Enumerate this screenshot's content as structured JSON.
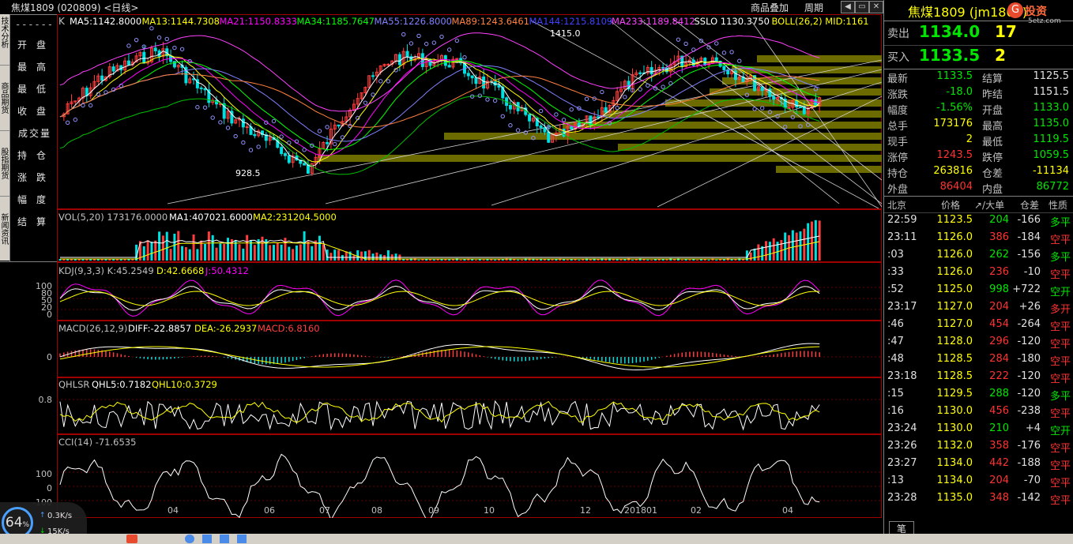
{
  "window": {
    "title": "焦煤1809 (020809) <日线>",
    "links": [
      "商品叠加",
      "周期"
    ]
  },
  "left_tabs": [
    "技术分析",
    "商品期货",
    "股指期货",
    "新闻资讯"
  ],
  "left_menu": [
    "开盘",
    "最高",
    "最低",
    "收盘",
    "成交量",
    "持仓",
    "涨跌",
    "幅度",
    "结算"
  ],
  "main_legend": {
    "prefix": "K",
    "items": [
      {
        "label": "MA5:1142.8000",
        "color": "#ffffff"
      },
      {
        "label": "MA13:1144.7308",
        "color": "#ffff00"
      },
      {
        "label": "MA21:1150.8333",
        "color": "#ff00ff"
      },
      {
        "label": "MA34:1185.7647",
        "color": "#00ff00"
      },
      {
        "label": "MA55:1226.8000",
        "color": "#8080ff"
      },
      {
        "label": "MA89:1243.6461",
        "color": "#ff8040"
      },
      {
        "label": "MA144:1215.8109",
        "color": "#4040ff"
      },
      {
        "label": "MA233:1189.8412",
        "color": "#ff40ff"
      },
      {
        "label": "SSLO 1130.3750",
        "color": "#ffffff"
      },
      {
        "label": "BOLL(26,2) MID:1161",
        "color": "#ffff00"
      }
    ],
    "high_mark": "1415.0",
    "low_mark": "928.5"
  },
  "vol_legend": {
    "prefix": "VOL(5,20) 173176.0000",
    "ma1": "MA1:407021.6000",
    "ma2": "MA2:231204.5000"
  },
  "kdj_legend": {
    "prefix": "KDJ(9,3,3) K:45.2549",
    "d": "D:42.6668",
    "j": "J:50.4312",
    "ticks": [
      "100",
      "80",
      "50",
      "20",
      "0"
    ]
  },
  "macd_legend": {
    "prefix": "MACD(26,12,9)",
    "diff": "DIFF:-22.8857",
    "dea": "DEA:-26.2937",
    "macd": "MACD:6.8160",
    "tick": "0"
  },
  "qhlsr_legend": {
    "prefix": "QHLSR",
    "q5": "QHL5:0.7182",
    "q10": "QHL10:0.3729",
    "tick": "0.8"
  },
  "cci_legend": {
    "prefix": "CCI(14) -71.6535",
    "ticks": [
      "100",
      "0",
      "-100"
    ]
  },
  "x_axis": [
    "04",
    "06",
    "07",
    "08",
    "09",
    "10",
    "12",
    "201801",
    "02",
    "04"
  ],
  "quote": {
    "title": "焦煤1809 (jm1809)",
    "brand": "投资",
    "brand_sub": "5etz.com",
    "sell": {
      "label": "卖出",
      "price": "1134.0",
      "qty": "17"
    },
    "buy": {
      "label": "买入",
      "price": "1133.5",
      "qty": "2"
    },
    "rows": [
      {
        "l1": "最新",
        "v1": "1133.5",
        "c1": "dn",
        "l2": "结算",
        "v2": "1125.5",
        "c2": "wh"
      },
      {
        "l1": "涨跌",
        "v1": "-18.0",
        "c1": "dn",
        "l2": "昨结",
        "v2": "1151.5",
        "c2": "wh"
      },
      {
        "l1": "幅度",
        "v1": "-1.56%",
        "c1": "dn",
        "l2": "开盘",
        "v2": "1133.0",
        "c2": "dn"
      },
      {
        "l1": "总手",
        "v1": "173176",
        "c1": "yl",
        "l2": "最高",
        "v2": "1135.0",
        "c2": "dn"
      },
      {
        "l1": "现手",
        "v1": "2",
        "c1": "yl",
        "l2": "最低",
        "v2": "1119.5",
        "c2": "dn"
      },
      {
        "l1": "涨停",
        "v1": "1243.5",
        "c1": "up",
        "l2": "跌停",
        "v2": "1059.5",
        "c2": "dn"
      },
      {
        "l1": "持仓",
        "v1": "263816",
        "c1": "yl",
        "l2": "仓差",
        "v2": "-11134",
        "c2": "yl"
      },
      {
        "l1": "外盘",
        "v1": "86404",
        "c1": "up",
        "l2": "内盘",
        "v2": "86772",
        "c2": "dn"
      }
    ],
    "tick_header": [
      "北京",
      "价格",
      "↗/大单",
      "仓差",
      "性质"
    ],
    "ticks": [
      {
        "time": "22:59",
        "price": "1123.5",
        "vol": "204",
        "oi": "-166",
        "nature": "多平",
        "nc": "dn"
      },
      {
        "time": "23:11",
        "price": "1126.0",
        "vol": "386",
        "oi": "-184",
        "nature": "空平",
        "nc": "up"
      },
      {
        "time": ":03",
        "price": "1126.0",
        "vol": "262",
        "oi": "-156",
        "nature": "多平",
        "nc": "dn"
      },
      {
        "time": ":33",
        "price": "1126.0",
        "vol": "236",
        "oi": "-10",
        "nature": "空平",
        "nc": "up"
      },
      {
        "time": ":52",
        "price": "1125.0",
        "vol": "998",
        "oi": "+722",
        "nature": "空开",
        "nc": "dn"
      },
      {
        "time": "23:17",
        "price": "1127.0",
        "vol": "204",
        "oi": "+26",
        "nature": "多开",
        "nc": "up"
      },
      {
        "time": ":46",
        "price": "1127.0",
        "vol": "454",
        "oi": "-264",
        "nature": "空平",
        "nc": "up"
      },
      {
        "time": ":47",
        "price": "1128.0",
        "vol": "296",
        "oi": "-120",
        "nature": "空平",
        "nc": "up"
      },
      {
        "time": ":48",
        "price": "1128.5",
        "vol": "284",
        "oi": "-180",
        "nature": "空平",
        "nc": "up"
      },
      {
        "time": "23:18",
        "price": "1128.5",
        "vol": "222",
        "oi": "-120",
        "nature": "空平",
        "nc": "up"
      },
      {
        "time": ":15",
        "price": "1129.5",
        "vol": "288",
        "oi": "-120",
        "nature": "多平",
        "nc": "dn"
      },
      {
        "time": ":16",
        "price": "1130.0",
        "vol": "456",
        "oi": "-238",
        "nature": "空平",
        "nc": "up"
      },
      {
        "time": "23:24",
        "price": "1130.0",
        "vol": "210",
        "oi": "+4",
        "nature": "空开",
        "nc": "dn"
      },
      {
        "time": "23:26",
        "price": "1132.0",
        "vol": "358",
        "oi": "-176",
        "nature": "空平",
        "nc": "up"
      },
      {
        "time": "23:27",
        "price": "1134.0",
        "vol": "442",
        "oi": "-188",
        "nature": "空平",
        "nc": "up"
      },
      {
        "time": ":13",
        "price": "1134.0",
        "vol": "204",
        "oi": "-70",
        "nature": "空平",
        "nc": "up"
      },
      {
        "time": "23:28",
        "price": "1135.0",
        "vol": "348",
        "oi": "-142",
        "nature": "空平",
        "nc": "up"
      }
    ],
    "footer_tab": "笔"
  },
  "net_meter": {
    "percent": "64",
    "percent_sign": "%",
    "up": "0.3K/s",
    "down": "15K/s"
  }
}
